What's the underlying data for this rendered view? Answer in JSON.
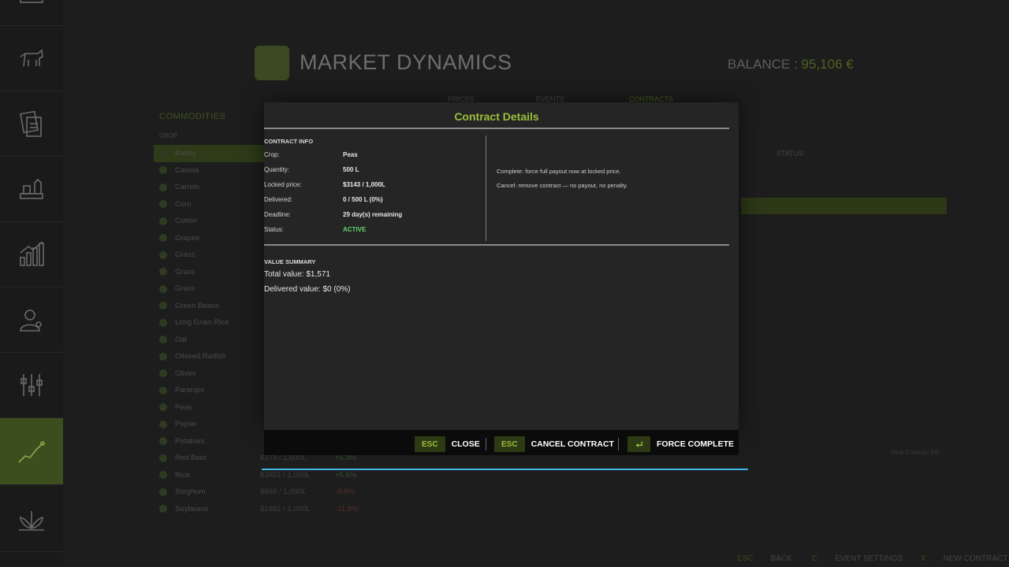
{
  "app": {
    "title": "MARKET DYNAMICS",
    "balance_label": "BALANCE :",
    "balance_value": "95,106 €"
  },
  "sidebar": {
    "items": [
      {
        "icon": "calendar-icon"
      },
      {
        "icon": "cow-icon"
      },
      {
        "icon": "notes-icon"
      },
      {
        "icon": "production-icon"
      },
      {
        "icon": "stats-icon"
      },
      {
        "icon": "worker-icon"
      },
      {
        "icon": "settings-sliders-icon"
      },
      {
        "icon": "market-chart-icon",
        "active": true
      },
      {
        "icon": "plant-icon"
      }
    ]
  },
  "tabs": [
    "PRICES",
    "EVENTS",
    "CONTRACTS"
  ],
  "commodities": {
    "title": "COMMODITIES",
    "crop_header": "CROP",
    "status_header": "STATUS",
    "rows": [
      {
        "name": "Barley",
        "price": "",
        "change": ""
      },
      {
        "name": "Canola",
        "price": "",
        "change": ""
      },
      {
        "name": "Carrots",
        "price": "",
        "change": ""
      },
      {
        "name": "Corn",
        "price": "",
        "change": ""
      },
      {
        "name": "Cotton",
        "price": "",
        "change": ""
      },
      {
        "name": "Grapes",
        "price": "",
        "change": ""
      },
      {
        "name": "Grass",
        "price": "",
        "change": ""
      },
      {
        "name": "Grass",
        "price": "",
        "change": ""
      },
      {
        "name": "Grass",
        "price": "",
        "change": ""
      },
      {
        "name": "Green Beans",
        "price": "",
        "change": ""
      },
      {
        "name": "Long Grain Rice",
        "price": "",
        "change": ""
      },
      {
        "name": "Oat",
        "price": "",
        "change": ""
      },
      {
        "name": "Oilseed Radish",
        "price": "",
        "change": ""
      },
      {
        "name": "Olives",
        "price": "",
        "change": ""
      },
      {
        "name": "Parsnips",
        "price": "",
        "change": ""
      },
      {
        "name": "Peas",
        "price": "",
        "change": ""
      },
      {
        "name": "Poplar",
        "price": "",
        "change": ""
      },
      {
        "name": "Potatoes",
        "price": "",
        "change": ""
      },
      {
        "name": "Red Beet",
        "price": "$379 / 1,000L",
        "change": "+5.3%"
      },
      {
        "name": "Rice",
        "price": "$3651 / 1,000L",
        "change": "+5.6%"
      },
      {
        "name": "Sorghum",
        "price": "$968 / 1,000L",
        "change": "-9.6%"
      },
      {
        "name": "Soybeans",
        "price": "$1981 / 1,000L",
        "change": "-11.8%"
      }
    ],
    "new_contract_hint": "New Contract [N]"
  },
  "modal": {
    "title": "Contract Details",
    "contract_info_label": "CONTRACT INFO",
    "info": [
      {
        "label": "Crop:",
        "value": "Peas"
      },
      {
        "label": "Quantity:",
        "value": "500 L"
      },
      {
        "label": "Locked price:",
        "value": "$3143 / 1,000L"
      },
      {
        "label": "Delivered:",
        "value": "0 / 500 L  (0%)"
      },
      {
        "label": "Deadline:",
        "value": "29 day(s) remaining"
      },
      {
        "label": "Status:",
        "value": "ACTIVE"
      }
    ],
    "help": [
      "Complete: force full payout now at locked price.",
      "Cancel: remove contract — no payout, no penalty."
    ],
    "value_summary_label": "VALUE SUMMARY",
    "total_value": "Total value:  $1,571",
    "delivered_value": "Delivered value:  $0  (0%)"
  },
  "actions": {
    "close_key": "ESC",
    "close_label": "CLOSE",
    "cancel_key": "ESC",
    "cancel_label": "CANCEL CONTRACT",
    "force_label": "FORCE COMPLETE"
  },
  "footer": {
    "back_key": "ESC",
    "back_label": "BACK",
    "settings_key": "C",
    "settings_label": "EVENT SETTINGS",
    "new_key": "X",
    "new_label": "NEW CONTRACT"
  },
  "colors": {
    "accent": "#9bbf3a",
    "active_status": "#5fd66a",
    "progress_line": "#3fb7e8"
  }
}
